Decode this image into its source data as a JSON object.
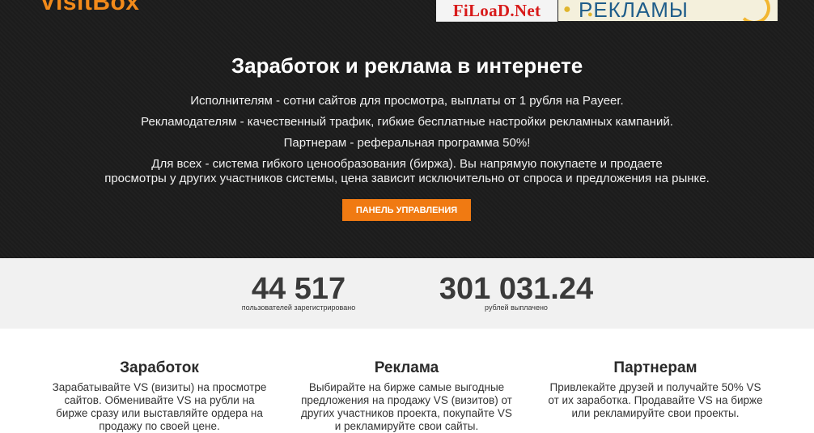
{
  "header": {
    "logo": "VisitBox",
    "banner_left": "FiLoaD.Net",
    "banner_right": "РЕКЛАМЫ"
  },
  "hero": {
    "title": "Заработок и реклама в интернете",
    "line1": "Исполнителям - сотни сайтов для просмотра, выплаты от 1 рубля на Payeer.",
    "line2": "Рекламодателям - качественный трафик, гибкие бесплатные настройки рекламных кампаний.",
    "line3": "Партнерам - реферальная программа 50%!",
    "line4a": "Для всех - система гибкого ценообразования (биржа). Вы напрямую покупаете и продаете",
    "line4b": "просмотры у других участников системы, цена зависит исключительно от спроса и предложения на рынке.",
    "button": "ПАНЕЛЬ УПРАВЛЕНИЯ"
  },
  "stats": [
    {
      "value": "44 517",
      "label": "пользователей зарегистрировано"
    },
    {
      "value": "301 031.24",
      "label": "рублей выплачено"
    }
  ],
  "features": [
    {
      "title": "Заработок",
      "text1": "Зарабатывайте VS (визиты) на просмотре",
      "text2": "сайтов. Обменивайте VS на рубли на",
      "text3": "бирже сразу или выставляйте ордера на",
      "text4": "продажу по своей цене."
    },
    {
      "title": "Реклама",
      "text1": "Выбирайте на бирже самые выгодные",
      "text2": "предложения на продажу VS (визитов) от",
      "text3": "других участников проекта, покупайте VS",
      "text4": "и рекламируйте свои сайты."
    },
    {
      "title": "Партнерам",
      "text1": "Привлекайте друзей и получайте 50% VS",
      "text2": "от их заработка. Продавайте VS на бирже",
      "text3": "или рекламируйте свои проекты."
    }
  ],
  "colors": {
    "accent": "#f07a12",
    "hero_bg": "#1d1d1d",
    "stats_bg": "#f1f1f1"
  }
}
